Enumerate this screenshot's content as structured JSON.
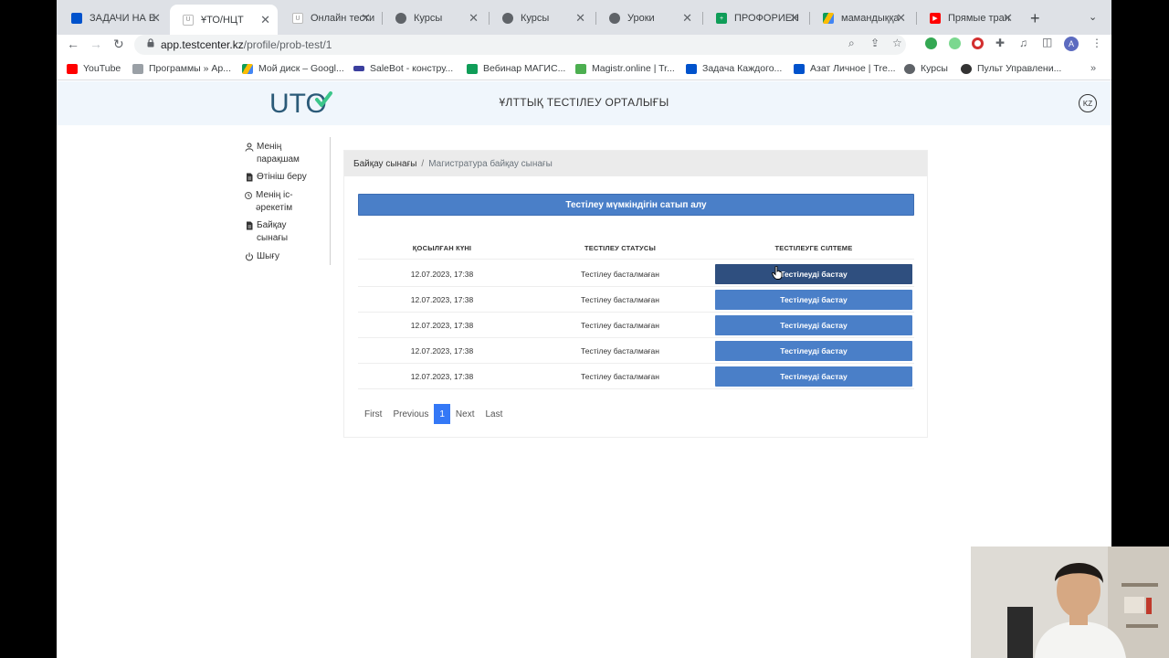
{
  "browser": {
    "tabs": [
      {
        "label": "ЗАДАЧИ НА Е",
        "icon": "trello-icon",
        "color": "#0052cc"
      },
      {
        "label": "ҰТО/НЦТ",
        "icon": "uto-icon",
        "color": "#9aa0a6"
      },
      {
        "label": "Онлайн тести",
        "icon": "uto-icon",
        "color": "#9aa0a6"
      },
      {
        "label": "Курсы",
        "icon": "globe-icon",
        "color": "#5f6368"
      },
      {
        "label": "Курсы",
        "icon": "globe-icon",
        "color": "#5f6368"
      },
      {
        "label": "Уроки",
        "icon": "globe-icon",
        "color": "#5f6368"
      },
      {
        "label": "ПРОФОРИЕН",
        "icon": "sheets-icon",
        "color": "#0f9d58"
      },
      {
        "label": "мамандыққа",
        "icon": "drive-icon",
        "color": "#fbbc04"
      },
      {
        "label": "Прямые тран",
        "icon": "youtube-icon",
        "color": "#ff0000"
      }
    ],
    "active_tab": 1,
    "url_host": "app.testcenter.kz",
    "url_path": "/profile/prob-test/1",
    "profile_initial": "A",
    "bookmarks": [
      {
        "label": "YouTube",
        "color": "#ff0000"
      },
      {
        "label": "Программы » Ар...",
        "color": "#9aa0a6"
      },
      {
        "label": "Мой диск – Googl...",
        "color": "#fbbc04"
      },
      {
        "label": "SaleBot - констру...",
        "color": "#3b3f9e"
      },
      {
        "label": "Вебинар МАГИС...",
        "color": "#0f9d58"
      },
      {
        "label": "Magistr.online | Tr...",
        "color": "#4caf50"
      },
      {
        "label": "Задача Каждого...",
        "color": "#0052cc"
      },
      {
        "label": "Азат Личное | Tre...",
        "color": "#0052cc"
      },
      {
        "label": "Курсы",
        "color": "#5f6368"
      },
      {
        "label": "Пульт Управлени...",
        "color": "#333333"
      }
    ]
  },
  "site": {
    "logo_text": "UTO",
    "title": "ҰЛТТЫҚ ТЕСТІЛЕУ ОРТАЛЫҒЫ",
    "lang": "KZ"
  },
  "sidebar": {
    "items": [
      {
        "label": "Менің парақшам",
        "icon": "user-icon"
      },
      {
        "label": "Өтініш беру",
        "icon": "document-icon"
      },
      {
        "label": "Менің іс-әрекетім",
        "icon": "history-icon"
      },
      {
        "label": "Байқау сынағы",
        "icon": "document-icon"
      },
      {
        "label": "Шығу",
        "icon": "power-icon"
      }
    ]
  },
  "main": {
    "breadcrumb": [
      "Байқау сынағы",
      "Магистратура байқау сынағы"
    ],
    "buy_button": "Тестілеу мүмкіндігін сатып алу",
    "columns": [
      "ҚОСЫЛҒАН КҮНІ",
      "ТЕСТІЛЕУ СТАТУСЫ",
      "ТЕСТІЛЕУГЕ СІЛТЕМЕ"
    ],
    "rows": [
      {
        "date": "12.07.2023, 17:38",
        "status": "Тестілеу басталмаған",
        "action": "Тестілеуді бастау"
      },
      {
        "date": "12.07.2023, 17:38",
        "status": "Тестілеу басталмаған",
        "action": "Тестілеуді бастау"
      },
      {
        "date": "12.07.2023, 17:38",
        "status": "Тестілеу басталмаған",
        "action": "Тестілеуді бастау"
      },
      {
        "date": "12.07.2023, 17:38",
        "status": "Тестілеу басталмаған",
        "action": "Тестілеуді бастау"
      },
      {
        "date": "12.07.2023, 17:38",
        "status": "Тестілеу басталмаған",
        "action": "Тестілеуді бастау"
      }
    ],
    "pagination": {
      "first": "First",
      "previous": "Previous",
      "current": "1",
      "next": "Next",
      "last": "Last"
    }
  },
  "colors": {
    "accent": "#4a7fc8",
    "accent_hover": "#2f4f7f",
    "page_active": "#3478f6",
    "header_bg": "#f0f6fc",
    "logo_check": "#3cc68a"
  }
}
